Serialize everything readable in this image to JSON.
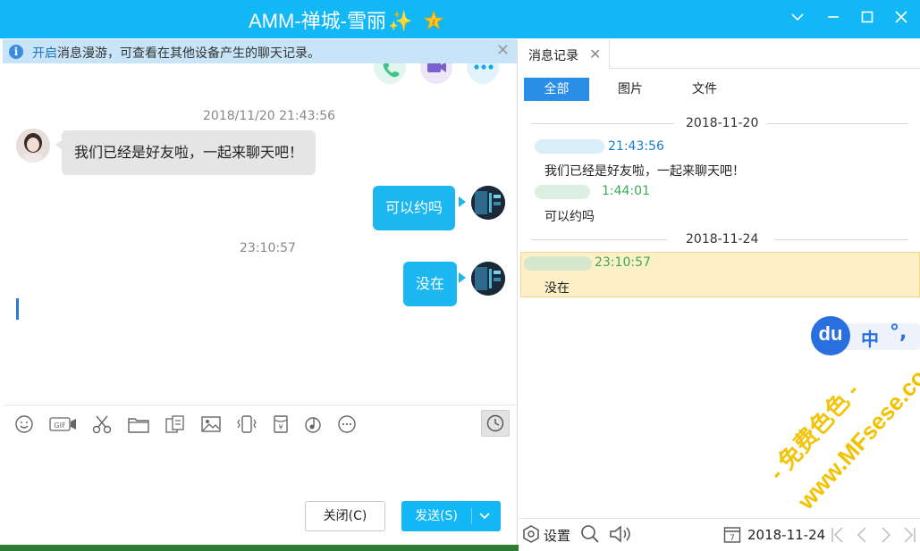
{
  "window": {
    "title": "AMM-禅城-雪丽",
    "title_emoji": "✨",
    "colors": {
      "accent": "#12b7f5",
      "bubble_out": "#1cb7f0",
      "bubble_in": "#e5e5e5",
      "highlight": "#fdf0c8"
    }
  },
  "notice": {
    "link": "开启",
    "text": "消息漫游，可查看在其他设备产生的聊天记录。"
  },
  "chat": {
    "messages": [
      {
        "timestamp": "2018/11/20 21:43:56",
        "direction": "in",
        "text": "我们已经是好友啦，一起来聊天吧！"
      },
      {
        "direction": "out",
        "text": "可以约吗"
      },
      {
        "timestamp": "23:10:57",
        "direction": "out",
        "text": "没在"
      }
    ]
  },
  "toolbar": {
    "icons": [
      "emoji-icon",
      "gif-icon",
      "scissors-icon",
      "folder-icon",
      "doc-icon",
      "image-icon",
      "shake-icon",
      "redpacket-icon",
      "music-icon",
      "more-icon",
      "history-icon"
    ]
  },
  "buttons": {
    "close": "关闭(C)",
    "send": "发送(S)"
  },
  "history": {
    "tab": "消息记录",
    "filters": [
      "全部",
      "图片",
      "文件"
    ],
    "groups": [
      {
        "date": "2018-11-20",
        "items": [
          {
            "time": "21:43:56",
            "text": "我们已经是好友啦，一起来聊天吧！"
          },
          {
            "time": "1:44:01",
            "text": "可以约吗"
          }
        ]
      },
      {
        "date": "2018-11-24",
        "items": [
          {
            "time": "23:10:57",
            "text": "没在"
          }
        ]
      }
    ]
  },
  "ime": {
    "logo": "du",
    "mode": "中",
    "punct": "°,"
  },
  "bottom": {
    "settings": "设置",
    "date": "2018-11-24"
  },
  "watermark": {
    "line1": "- 免费色色 -",
    "line2": "www.MFsese.com"
  }
}
